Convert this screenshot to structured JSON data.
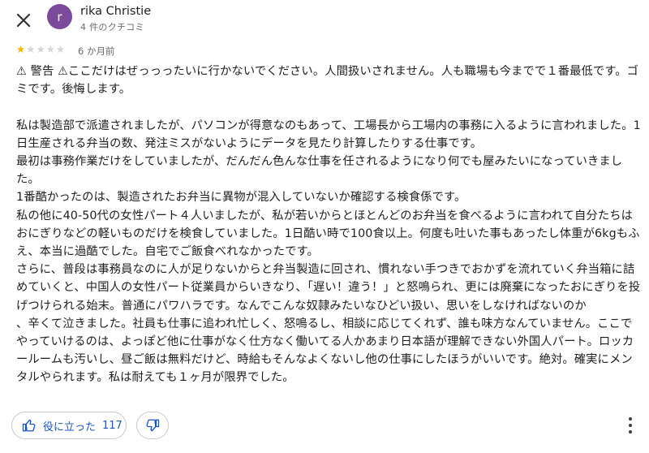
{
  "header": {
    "close_icon": "close-icon",
    "avatar_letter": "r",
    "avatar_color": "#7b4a9b",
    "author_name": "rika Christie",
    "review_count": "4 件のクチコミ"
  },
  "rating": {
    "stars": 1,
    "max_stars": 5,
    "star_color": "#f4b400",
    "date": "6 か月前"
  },
  "review": {
    "text": "⚠︎ 警告 ⚠︎ここだけはぜっっったいに行かないでください。人間扱いされません。人も職場も今までで１番最低です。ゴミです。後悔します。\n\n私は製造部で派遣されましたが、パソコンが得意なのもあって、工場長から工場内の事務に入るように言われました。1日生産される弁当の数、発注ミスがないようにデータを見たり計算したりする仕事です。\n最初は事務作業だけをしていましたが、だんだん色んな仕事を任されるようになり何でも屋みたいになっていきました。\n1番酷かったのは、製造されたお弁当に異物が混入していないか確認する検食係です。\n私の他に40-50代の女性パート４人いましたが、私が若いからとほとんどのお弁当を食べるように言われて自分たちはおにぎりなどの軽いものだけを検食していました。1日酷い時で100食以上。何度も吐いた事もあったし体重が6kgもふえ、本当に過酷でした。自宅でご飯食べれなかったです。\nさらに、普段は事務員なのに人が足りないからと弁当製造に回され、慣れない手つきでおかずを流れていく弁当箱に詰めていくと、中国人の女性パート従業員からいきなり、「遅い！違う！」と怒鳴られ、更には廃棄になったおにぎりを投げつけられる始末。普通にパワハラです。なんでこんな奴隷みたいなひどい扱い、思いをしなければないのか\n、辛くて泣きました。社員も仕事に追われ忙しく、怒鳴るし、相談に応じてくれず、誰も味方なんていません。ここでやっていけるのは、よっぽど他に仕事がなく仕方なく働いてる人かあまり日本語が理解できない外国人パート。ロッカールームも汚いし、昼ご飯は無料だけど、時給もそんなよくないし他の仕事にしたほうがいいです。絶対。確実にメンタルやられます。私は耐えても１ヶ月が限界でした。"
  },
  "actions": {
    "helpful_label": "役に立った",
    "helpful_count": "117",
    "accent_color": "#1a56c8",
    "helpful_icon": "thumbs-up-icon",
    "dislike_icon": "thumbs-down-icon",
    "more_icon": "more-vert-icon"
  }
}
